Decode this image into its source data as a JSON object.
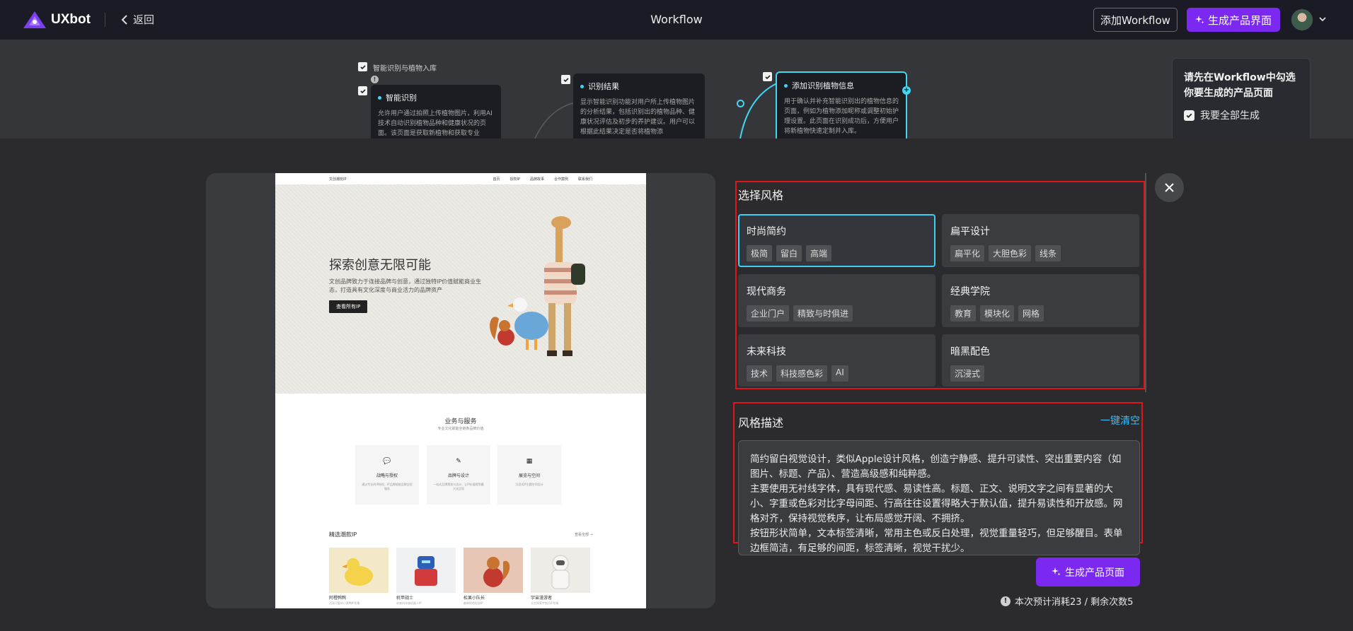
{
  "app": {
    "brand": "UXbot",
    "back_label": "返回",
    "title": "Workflow",
    "add_workflow_label": "添加Workflow",
    "generate_ui_label": "生成产品界面"
  },
  "workflow": {
    "group_label": "智能识别与植物入库",
    "cards": [
      {
        "title": "智能识别",
        "desc": "允许用户通过拍照上传植物图片，利用AI技术自动识别植物品种和健康状况的页面。该页面是获取新植物和获取专业"
      },
      {
        "title": "识别结果",
        "desc": "显示智能识别功能对用户所上传植物图片的分析结果，包括识别出的植物品种、健康状况评估及初步的养护建议。用户可以根据此结果决定是否将植物添"
      },
      {
        "title": "添加识别植物信息",
        "desc": "用于确认并补充智能识别出的植物信息的页面，例如为植物添加昵称或调整初始护理设置。此页面在识别成功后，方便用户将新植物快速定制并入库。"
      }
    ],
    "side_panel": {
      "hint": "请先在Workflow中勾选你要生成的产品页面",
      "select_all_label": "我要全部生成"
    }
  },
  "preview": {
    "nav_brand": "文创潮玩IP",
    "nav_links": [
      "首页",
      "授权IP",
      "品牌故事",
      "合作案例",
      "联系我们"
    ],
    "hero_title": "探索创意无限可能",
    "hero_sub": "文创品牌致力于连接品牌与创意，通过独特IP价值赋能商业生态，打造具有文化深度与商业活力的品牌资产",
    "hero_button": "查看所有IP",
    "section_title": "业务与服务",
    "section_sub": "专业文化赋能全链条品牌价值",
    "services": [
      {
        "icon": "💬",
        "title": "战略与授权",
        "desc": "通过专业的IP授权，IP品牌赋能品牌全程服务"
      },
      {
        "icon": "✎",
        "title": "品牌与设计",
        "desc": "一站式品牌策划与设计，让IP价值得到最大化呈现"
      },
      {
        "icon": "▦",
        "title": "展览与空间",
        "desc": "沉浸式IP主题空间设计"
      }
    ],
    "ip_title": "精选潮款IP",
    "ip_more": "查看全部 →",
    "ips": [
      {
        "name": "阿橙鸭鸭",
        "desc": "活泼可爱的小黄鸭IP形象"
      },
      {
        "name": "机甲战士",
        "desc": "未来科技感机器人IP"
      },
      {
        "name": "松果小队长",
        "desc": "森林探险松鼠IP"
      },
      {
        "name": "宇宙漫游者",
        "desc": "太空探索宇航员IP形象"
      }
    ]
  },
  "style": {
    "heading": "选择风格",
    "options": [
      {
        "title": "时尚简约",
        "tags": [
          "极简",
          "留白",
          "高端"
        ],
        "selected": true
      },
      {
        "title": "扁平设计",
        "tags": [
          "扁平化",
          "大胆色彩",
          "线条"
        ],
        "selected": false
      },
      {
        "title": "现代商务",
        "tags": [
          "企业门户",
          "精致与时俱进"
        ],
        "selected": false
      },
      {
        "title": "经典学院",
        "tags": [
          "教育",
          "模块化",
          "网格"
        ],
        "selected": false
      },
      {
        "title": "未来科技",
        "tags": [
          "技术",
          "科技感色彩",
          "AI"
        ],
        "selected": false
      },
      {
        "title": "暗黑配色",
        "tags": [
          "沉浸式"
        ],
        "selected": false
      }
    ]
  },
  "description": {
    "heading": "风格描述",
    "clear_label": "一键清空",
    "text": "简约留白视觉设计，类似Apple设计风格，创造宁静感、提升可读性、突出重要内容（如图片、标题、产品）、营造高级感和纯粹感。\n主要使用无衬线字体，具有现代感、易读性高。标题、正文、说明文字之间有显著的大小、字重或色彩对比字母间距、行高往往设置得略大于默认值，提升易读性和开放感。网格对齐，保持视觉秩序，让布局感觉开阔、不拥挤。\n按钮形状简单，文本标签清晰，常用主色或反白处理，视觉重量轻巧，但足够醒目。表单边框简洁，有足够的间距，标签清晰，视觉干扰少。"
  },
  "footer": {
    "generate_page_label": "生成产品页面",
    "cost_text": "本次预计消耗23 / 剩余次数5"
  },
  "colors": {
    "accent": "#7b28f0",
    "selected_border": "#3fcdf0",
    "highlight_box": "#e0141a",
    "link": "#38bdf8"
  }
}
